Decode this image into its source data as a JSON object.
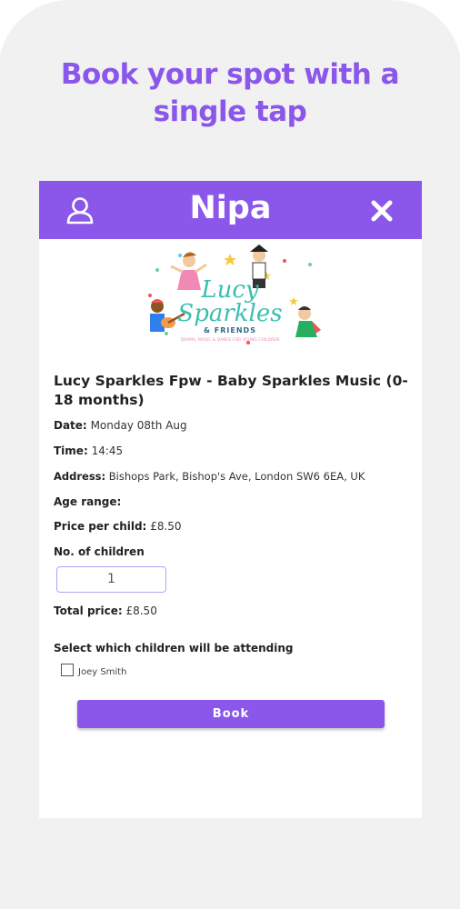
{
  "promo": {
    "headline_line1": "Book your spot with a",
    "headline_line2": "single tap"
  },
  "app": {
    "title": "Nipa",
    "user_icon": "user-icon",
    "close_icon": "close-icon",
    "accent_color": "#8b57ea"
  },
  "logo": {
    "line1": "Lucy",
    "line2": "Sparkles",
    "line3": "& FRIENDS",
    "tagline": "DRAMA, MUSIC & DANCE FOR YOUNG CHILDREN"
  },
  "event": {
    "title": "Lucy Sparkles Fpw - Baby Sparkles Music (0-18 months)",
    "date_label": "Date:",
    "date_value": "Monday 08th Aug",
    "time_label": "Time:",
    "time_value": "14:45",
    "address_label": "Address:",
    "address_value": "Bishops Park, Bishop's Ave, London SW6 6EA, UK",
    "age_label": "Age range:",
    "price_label": "Price per child:",
    "price_value": "£8.50"
  },
  "booking": {
    "children_label": "No. of children",
    "children_value": "1",
    "total_label": "Total price:",
    "total_value": "£8.50",
    "select_label": "Select which children will be attending",
    "child_name": "Joey Smith",
    "book_label": "Book"
  }
}
